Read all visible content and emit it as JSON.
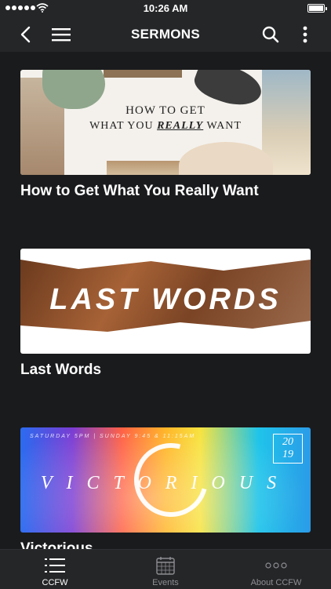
{
  "status_bar": {
    "time": "10:26 AM",
    "battery_level": 1.0
  },
  "nav_bar": {
    "title": "SERMONS",
    "icons": {
      "back": "back-arrow-icon",
      "menu": "hamburger-menu-icon",
      "search": "search-icon",
      "more": "more-vertical-icon"
    }
  },
  "sermons": [
    {
      "title": "How to Get What You Really Want",
      "artwork": {
        "line1": "HOW TO GET",
        "line2_a": "WHAT YOU ",
        "line2_emph": "REALLY",
        "line2_b": " WANT"
      }
    },
    {
      "title": "Last Words",
      "artwork": {
        "text": "LAST WORDS"
      }
    },
    {
      "title": "Victorious",
      "artwork": {
        "text": "VICTORIOUS",
        "schedule": "SATURDAY 5PM | SUNDAY 9:45 & 11:15AM",
        "year_top": "20",
        "year_bottom": "19"
      }
    }
  ],
  "tab_bar": {
    "colors": {
      "active": "#ffffff",
      "inactive": "#8e8e93"
    },
    "tabs": [
      {
        "label": "CCFW",
        "icon": "list-icon",
        "active": true
      },
      {
        "label": "Events",
        "icon": "calendar-icon",
        "active": false
      },
      {
        "label": "About CCFW",
        "icon": "ellipsis-icon",
        "active": false
      }
    ]
  }
}
